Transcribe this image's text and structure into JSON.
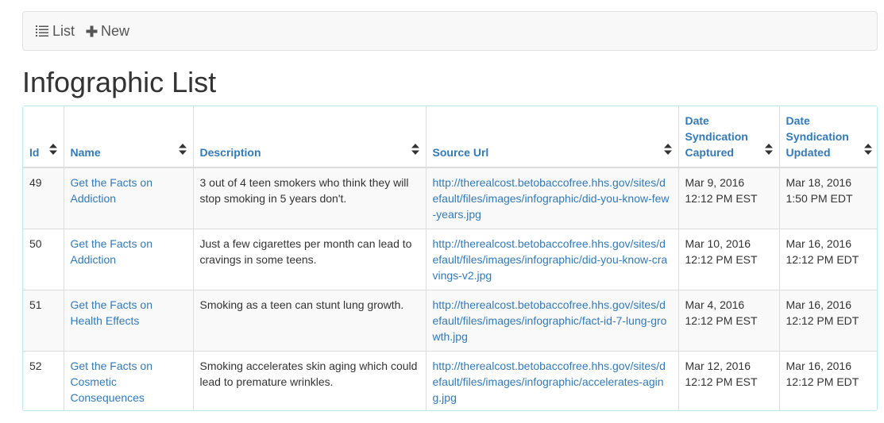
{
  "nav": {
    "list_label": "List",
    "new_label": "New"
  },
  "page": {
    "title": "Infographic List"
  },
  "table": {
    "headers": {
      "id": "Id",
      "name": "Name",
      "description": "Description",
      "source_url": "Source Url",
      "date_captured": "Date Syndication Captured",
      "date_updated": "Date Syndication Updated"
    },
    "rows": [
      {
        "id": "49",
        "name": "Get the Facts on Addiction",
        "description": "3 out of 4 teen smokers who think they will stop smoking in 5 years don't.",
        "source_url": "http://therealcost.betobaccofree.hhs.gov/sites/default/files/images/infographic/did-you-know-few-years.jpg",
        "captured_date": "Mar 9, 2016",
        "captured_time": "12:12 PM EST",
        "updated_date": "Mar 18, 2016",
        "updated_time": "1:50 PM EDT"
      },
      {
        "id": "50",
        "name": "Get the Facts on Addiction",
        "description": "Just a few cigarettes per month can lead to cravings in some teens.",
        "source_url": "http://therealcost.betobaccofree.hhs.gov/sites/default/files/images/infographic/did-you-know-cravings-v2.jpg",
        "captured_date": "Mar 10, 2016",
        "captured_time": "12:12 PM EST",
        "updated_date": "Mar 16, 2016",
        "updated_time": "12:12 PM EDT"
      },
      {
        "id": "51",
        "name": "Get the Facts on Health Effects",
        "description": "Smoking as a teen can stunt lung growth.",
        "source_url": "http://therealcost.betobaccofree.hhs.gov/sites/default/files/images/infographic/fact-id-7-lung-growth.jpg",
        "captured_date": "Mar 4, 2016",
        "captured_time": "12:12 PM EST",
        "updated_date": "Mar 16, 2016",
        "updated_time": "12:12 PM EDT"
      },
      {
        "id": "52",
        "name": "Get the Facts on Cosmetic Consequences",
        "description": "Smoking accelerates skin aging which could lead to premature wrinkles.",
        "source_url": "http://therealcost.betobaccofree.hhs.gov/sites/default/files/images/infographic/accelerates-aging.jpg",
        "captured_date": "Mar 12, 2016",
        "captured_time": "12:12 PM EST",
        "updated_date": "Mar 16, 2016",
        "updated_time": "12:12 PM EDT"
      }
    ]
  },
  "colors": {
    "link": "#337ab7",
    "border_info": "#bce8f1",
    "navbar_bg": "#f8f8f8",
    "stripe": "#f9f9f9"
  },
  "icons": {
    "list": "list-icon",
    "new": "plus-icon",
    "sort": "sort-icon"
  }
}
